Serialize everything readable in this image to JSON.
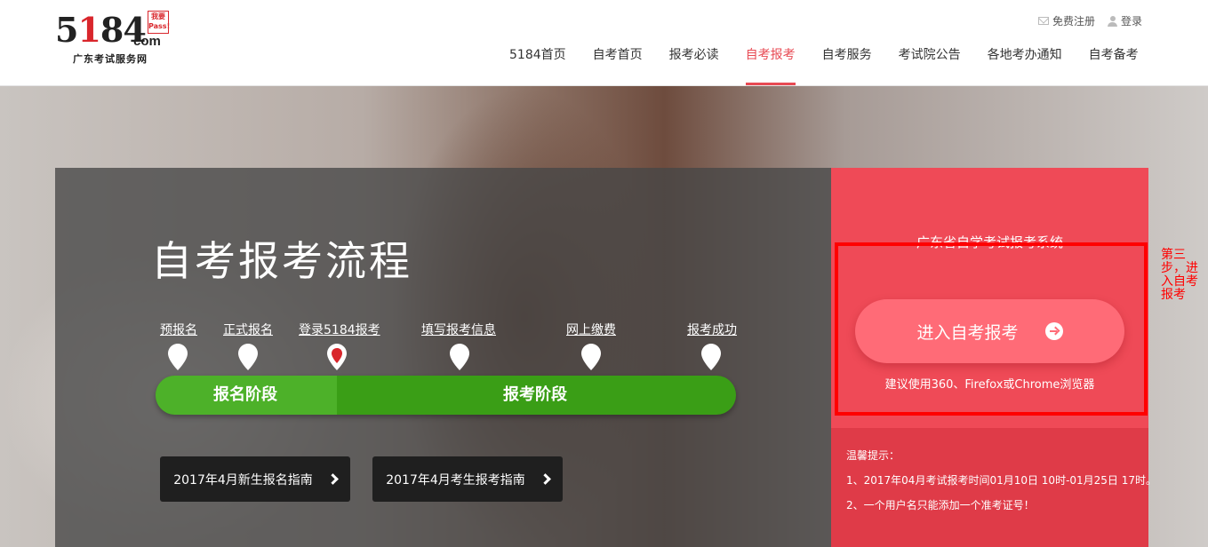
{
  "logo": {
    "mark_left": "5",
    "mark_red": "1",
    "mark_right": "84",
    "com": "com",
    "stamp": "我要Pass!",
    "subtitle": "广东考试服务网"
  },
  "toplinks": {
    "register": "免费注册",
    "login": "登录"
  },
  "nav": {
    "items": [
      "5184首页",
      "自考首页",
      "报考必读",
      "自考报考",
      "自考服务",
      "考试院公告",
      "各地考办通知",
      "自考备考"
    ],
    "active": "自考报考"
  },
  "hero": {
    "title": "自考报考流程",
    "steps": [
      "预报名",
      "正式报名",
      "登录5184报考",
      "填写报考信息",
      "网上缴费",
      "报考成功"
    ],
    "current_step": "登录5184报考",
    "stages": [
      "报名阶段",
      "报考阶段"
    ],
    "guides": [
      "2017年4月新生报名指南",
      "2017年4月考生报考指南"
    ]
  },
  "side": {
    "system_title": "广东省自学考试报考系统",
    "enter_button": "进入自考报考",
    "browser_tip": "建议使用360、Firefox或Chrome浏览器",
    "tips_title": "温馨提示：",
    "tips": [
      "1、2017年04月考试报考时间01月10日 10时-01月25日 17时。",
      "2、一个用户名只能添加一个准考证号！"
    ]
  },
  "annotation": "第三步，进入自考报考",
  "colors": {
    "accent": "#e84a53",
    "panel_red": "#ef4a57",
    "stage_green": "#3a9e16",
    "highlight": "#ff0000"
  }
}
